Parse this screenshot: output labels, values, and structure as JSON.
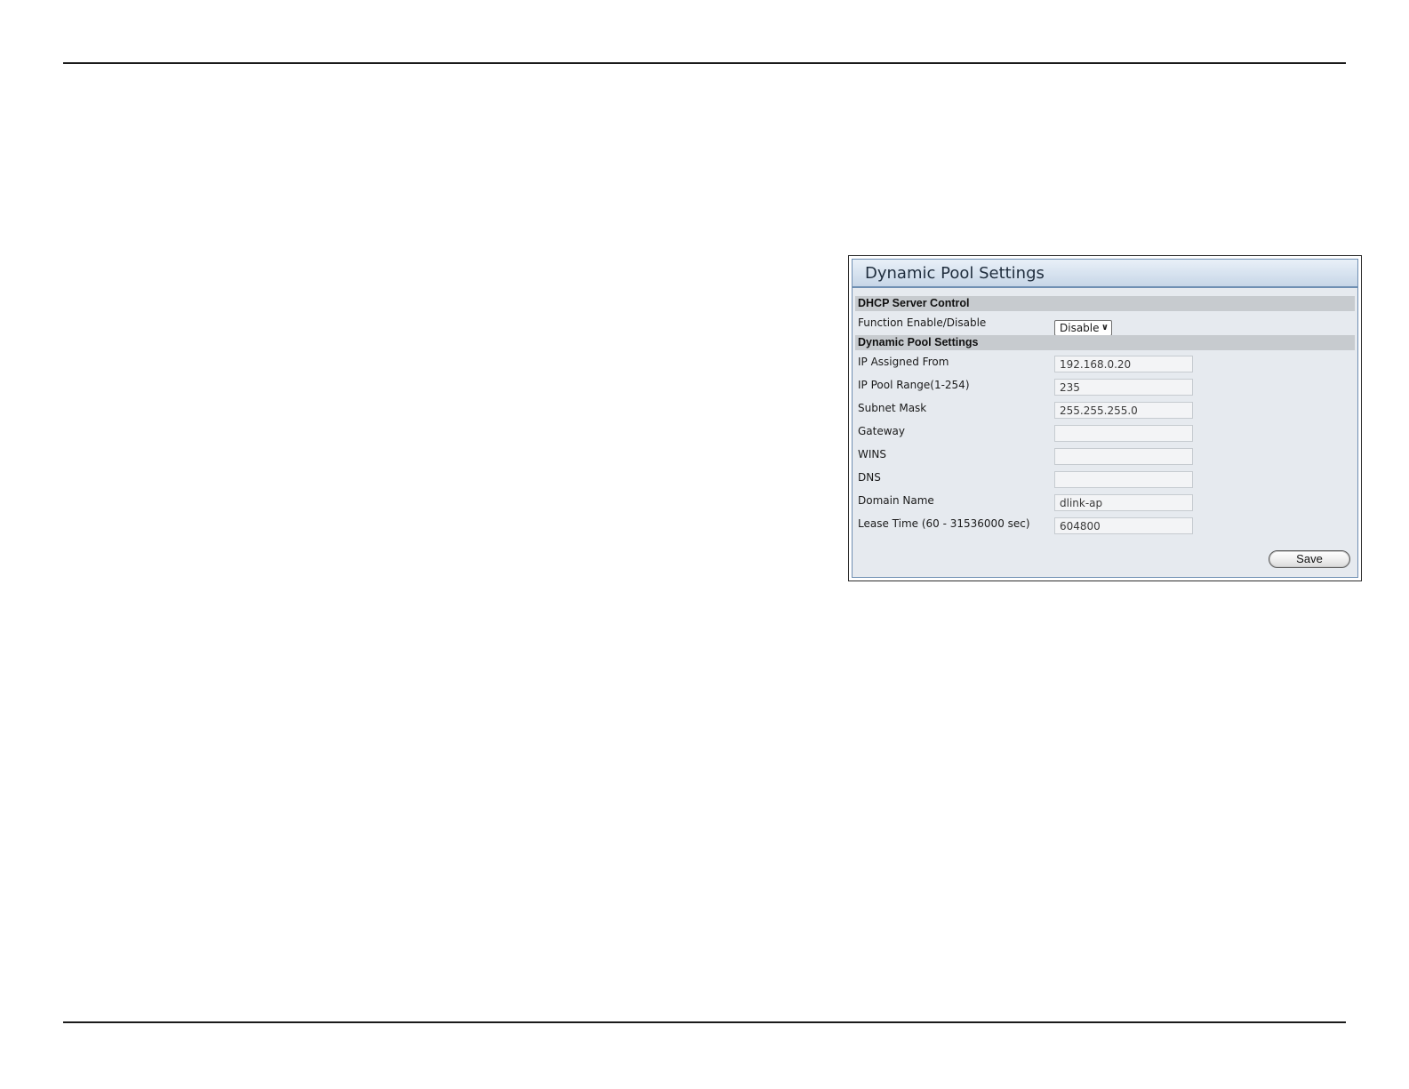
{
  "panel": {
    "title": "Dynamic Pool Settings"
  },
  "dhcp_control": {
    "section_title": "DHCP Server Control",
    "function_label": "Function Enable/Disable",
    "function_value": "Disable",
    "chevron": "∨"
  },
  "pool": {
    "section_title": "Dynamic Pool Settings",
    "rows": [
      {
        "label": "IP Assigned From",
        "value": "192.168.0.20"
      },
      {
        "label": "IP Pool Range(1-254)",
        "value": "235"
      },
      {
        "label": "Subnet Mask",
        "value": "255.255.255.0"
      },
      {
        "label": "Gateway",
        "value": ""
      },
      {
        "label": "WINS",
        "value": ""
      },
      {
        "label": "DNS",
        "value": ""
      },
      {
        "label": "Domain Name",
        "value": "dlink-ap"
      },
      {
        "label": "Lease Time (60 - 31536000 sec)",
        "value": "604800"
      }
    ]
  },
  "actions": {
    "save_label": "Save"
  },
  "colors": {
    "panel_border": "#6f8fb3",
    "panel_background": "#e6eaef",
    "section_bar": "#c7cbcf",
    "rule": "#1a1a1a"
  }
}
